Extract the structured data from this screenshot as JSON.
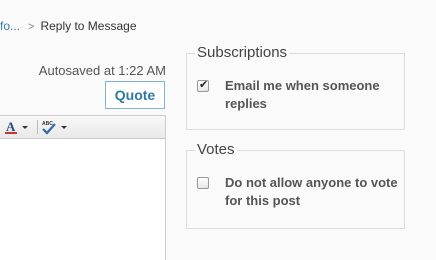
{
  "breadcrumb": {
    "parent": "fo...",
    "separator": ">",
    "current": "Reply to Message"
  },
  "editor": {
    "autosave_text": "Autosaved at 1:22 AM",
    "quote_label": "Quote",
    "toolbar": {
      "font_color_letter": "A",
      "spellcheck_text": "ABC"
    }
  },
  "subscriptions": {
    "legend": "Subscriptions",
    "email_label": "Email me when someone replies",
    "email_checked": true
  },
  "votes": {
    "legend": "Votes",
    "disable_label": "Do not allow anyone to vote for this post",
    "disable_checked": false
  },
  "colors": {
    "link": "#3b7ba8",
    "quote_border": "#7fb3cf",
    "quote_text": "#2f78a6",
    "font_color_underline": "#c0392b",
    "spell_check": "#2b6cb0"
  }
}
